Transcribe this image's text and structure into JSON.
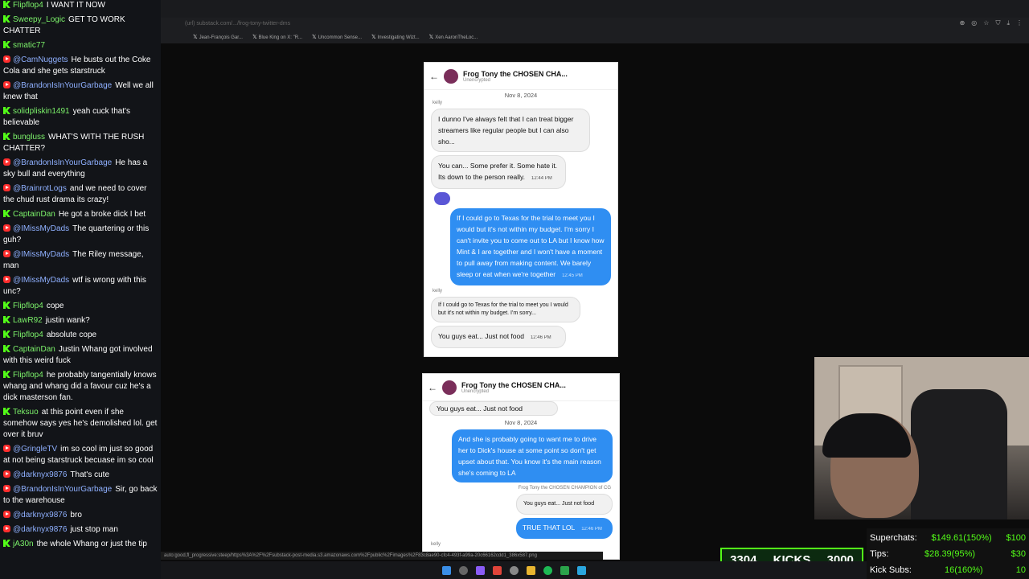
{
  "chat": {
    "messages": [
      {
        "platform": "kick",
        "user": "Flipflop4",
        "text": "I WANT IT NOW"
      },
      {
        "platform": "kick",
        "user": "Sweepy_Logic",
        "text": "GET TO WORK CHATTER"
      },
      {
        "platform": "kick",
        "user": "smatic77",
        "text": ""
      },
      {
        "platform": "yt",
        "user": "@CamNuggets",
        "text": "He busts out the Coke Cola and she gets starstruck"
      },
      {
        "platform": "yt",
        "user": "@BrandonIsInYourGarbage",
        "text": "Well we all knew that"
      },
      {
        "platform": "kick",
        "user": "solidpliskin1491",
        "text": "yeah cuck that's believable"
      },
      {
        "platform": "kick",
        "user": "bungluss",
        "text": "WHAT'S WITH THE RUSH CHATTER?"
      },
      {
        "platform": "yt",
        "user": "@BrandonIsInYourGarbage",
        "text": "He has a sky bull and everything"
      },
      {
        "platform": "yt",
        "user": "@BrainrotLogs",
        "text": "and we need to cover the chud rust drama its crazy!"
      },
      {
        "platform": "kick",
        "user": "CaptainDan",
        "text": "He got a broke dick I bet"
      },
      {
        "platform": "yt",
        "user": "@IMissMyDads",
        "text": "The quartering or this guh?"
      },
      {
        "platform": "yt",
        "user": "@IMissMyDads",
        "text": "The Riley message, man"
      },
      {
        "platform": "yt",
        "user": "@IMissMyDads",
        "text": "wtf is wrong with this unc?"
      },
      {
        "platform": "kick",
        "user": "Flipflop4",
        "text": "cope"
      },
      {
        "platform": "kick",
        "user": "LawR92",
        "text": "justin wank?"
      },
      {
        "platform": "kick",
        "user": "Flipflop4",
        "text": "absolute cope"
      },
      {
        "platform": "kick",
        "user": "CaptainDan",
        "text": "Justin Whang got involved with this weird fuck"
      },
      {
        "platform": "kick",
        "user": "Flipflop4",
        "text": "he probably tangentially knows whang and whang did a favour cuz he's a dick masterson fan."
      },
      {
        "platform": "kick",
        "user": "Teksuo",
        "text": "at this point even if she somehow says yes he's demolished lol. get over it bruv"
      },
      {
        "platform": "yt",
        "user": "@GringleTV",
        "text": "im so cool im just so good at not being starstruck becuase im so cool"
      },
      {
        "platform": "yt",
        "user": "@darknyx9876",
        "text": "That's cute"
      },
      {
        "platform": "yt",
        "user": "@BrandonIsInYourGarbage",
        "text": "Sir, go back to the warehouse"
      },
      {
        "platform": "yt",
        "user": "@darknyx9876",
        "text": "bro"
      },
      {
        "platform": "yt",
        "user": "@darknyx9876",
        "text": "just stop man"
      },
      {
        "platform": "kick",
        "user": "jA30n",
        "text": "the whole Whang or just the tip"
      }
    ]
  },
  "browser": {
    "address": "(url) substack.com/.../frog-tony-twitter-dms",
    "bookmarks": [
      "Jean-François Gar...",
      "Blue King on X: \"R...",
      "Uncommon Sense...",
      "Investigating Wizt...",
      "Xen AaronTheLoc..."
    ],
    "status_url": "auto:good,fl_progressive:steep/https%3A%2F%2Fsubstack-post-media.s3.amazonaws.com%2Fpublic%2Fimages%2F83c8ae90-cfc4-493f-a99a-20c66162cdd1_386x587.png"
  },
  "dm1": {
    "name": "Frog Tony the CHOSEN CHA...",
    "sub": "Unencrypted",
    "date": "Nov 8, 2024",
    "who1": "kelly",
    "in1": "I dunno I've always felt that I can treat bigger streamers like regular people but I can also sho...",
    "in2": "You can... Some prefer it. Some hate it. Its down to the person really.",
    "in2_time": "12:44 PM",
    "out1": "If I could go to Texas for the trial to meet you I would but it's not within my budget. I'm sorry I can't invite you to come out to LA but I know how Mint & I are together and I won't have a moment to pull away from making content. We barely sleep or eat when we're together",
    "out1_time": "12:45 PM",
    "who2": "kelly",
    "in3": "If I could go to Texas for the trial to meet you I would but it's not within my budget. I'm sorry...",
    "in4": "You guys eat... Just not food",
    "in4_time": "12:46 PM"
  },
  "dm2": {
    "name": "Frog Tony the CHOSEN CHA...",
    "sub": "Unencrypted",
    "top": "You guys eat... Just not food",
    "date": "Nov 8, 2024",
    "out1": "And she is probably going to want me to drive her to Dick's house at some point so don't get upset about that. You know it's the main reason she's coming to LA",
    "reply_ref": "Frog Tony the CHOSEN CHAMPION of CG",
    "reply_quote": "You guys eat... Just not food",
    "out2": "TRUE THAT LOL",
    "out2_time": "12:46 PM",
    "who": "kelly"
  },
  "counters": {
    "kicks_left": "3304",
    "kicks_label": "KICKS",
    "kicks_right": "3000",
    "superchats_label": "Superchats:",
    "superchats_value": "$149.61(150%)",
    "superchats_goal": "$100",
    "tips_label": "Tips:",
    "tips_value": "$28.39(95%)",
    "tips_goal": "$30",
    "subs_label": "Kick Subs:",
    "subs_value": "16(160%)",
    "subs_goal": "10"
  }
}
